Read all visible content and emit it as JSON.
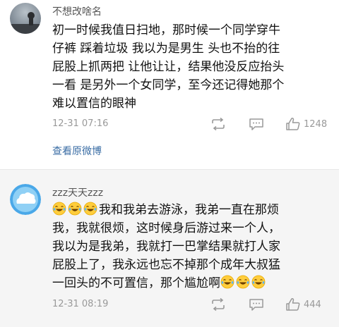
{
  "comments": [
    {
      "username": "不想改啥名",
      "lines": [
        "初一时候我值日扫地，那时候一个同学穿牛",
        "仔裤 踩着垃圾 我以为是男生 头也不抬的往",
        "屁股上抓两把 让他让让，结果他没反应抬头",
        "一看 是另外一个女同学，至今还记得她那个",
        "难以置信的眼神"
      ],
      "time": "12-31 07:16",
      "likes": "1248",
      "view_original": "查看原微博"
    },
    {
      "username": "zzz天天zzz",
      "line1_text": "我和我弟去游泳，我弟一直在那烦",
      "lines_middle": [
        "我，我就很烦，这时候身后游过来一个人，",
        "我以为是我弟，我就打一巴掌结果就打人家",
        "屁股上了，我永远也忘不掉那个成年大叔猛"
      ],
      "last_line_text": "一回头的不可置信，那个尴尬啊",
      "time": "12-31 08:19",
      "likes": "444"
    }
  ],
  "icons": {
    "repost": "repost-icon",
    "comment": "comment-icon",
    "like": "like-icon",
    "emoji": "laughing-tears-emoji-icon"
  },
  "colors": {
    "link": "#3b6ea5",
    "meta": "#999999",
    "second_bg": "#f5f5f5"
  }
}
